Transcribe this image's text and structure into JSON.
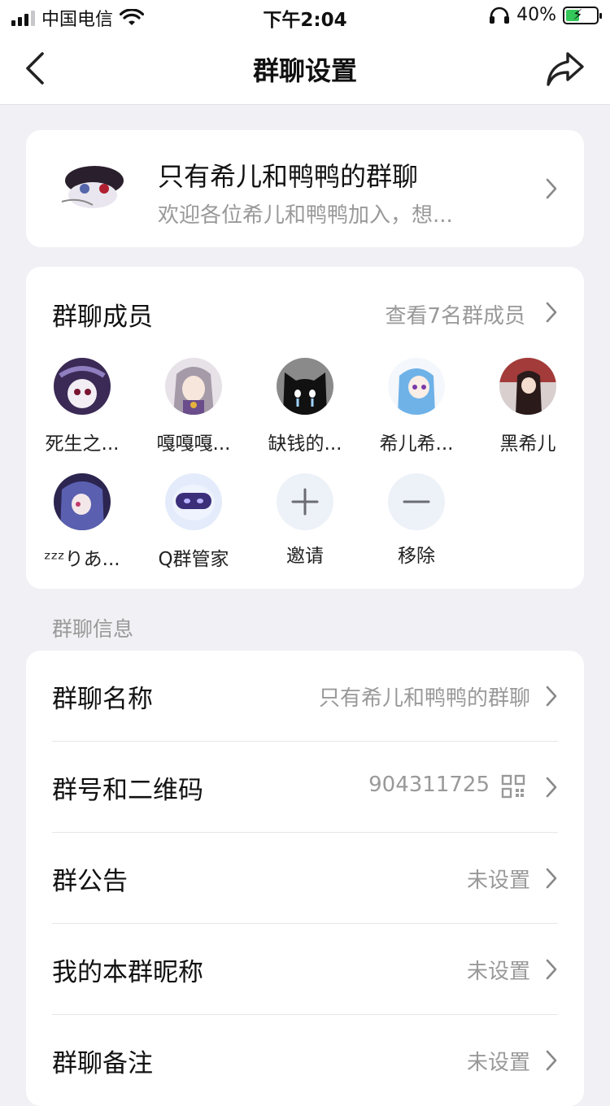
{
  "status_bar": {
    "carrier": "中国电信",
    "time": "下午2:04",
    "battery_percent": "40%"
  },
  "nav": {
    "title": "群聊设置"
  },
  "group": {
    "name": "只有希儿和鸭鸭的群聊",
    "description": "欢迎各位希儿和鸭鸭加入，想..."
  },
  "members": {
    "title": "群聊成员",
    "view_all": "查看7名群成员",
    "list": [
      {
        "name": "死生之..."
      },
      {
        "name": "嘎嘎嘎..."
      },
      {
        "name": "缺钱的..."
      },
      {
        "name": "希儿希..."
      },
      {
        "name": "黑希儿"
      },
      {
        "name": "ᶻᶻᶻりあ..."
      },
      {
        "name": "Q群管家"
      }
    ],
    "invite_label": "邀请",
    "remove_label": "移除"
  },
  "info_section": {
    "label": "群聊信息",
    "rows": [
      {
        "label": "群聊名称",
        "value": "只有希儿和鸭鸭的群聊"
      },
      {
        "label": "群号和二维码",
        "value": "904311725"
      },
      {
        "label": "群公告",
        "value": "未设置"
      },
      {
        "label": "我的本群昵称",
        "value": "未设置"
      },
      {
        "label": "群聊备注",
        "value": "未设置"
      }
    ]
  },
  "icons": [
    "back-icon",
    "share-icon",
    "chevron-right-icon",
    "qr-code-icon",
    "plus-icon",
    "minus-icon",
    "wifi-icon",
    "headphones-icon",
    "battery-icon",
    "signal-icon"
  ],
  "colors": {
    "battery_charge": "#34c759",
    "background": "#f0f0f5"
  }
}
